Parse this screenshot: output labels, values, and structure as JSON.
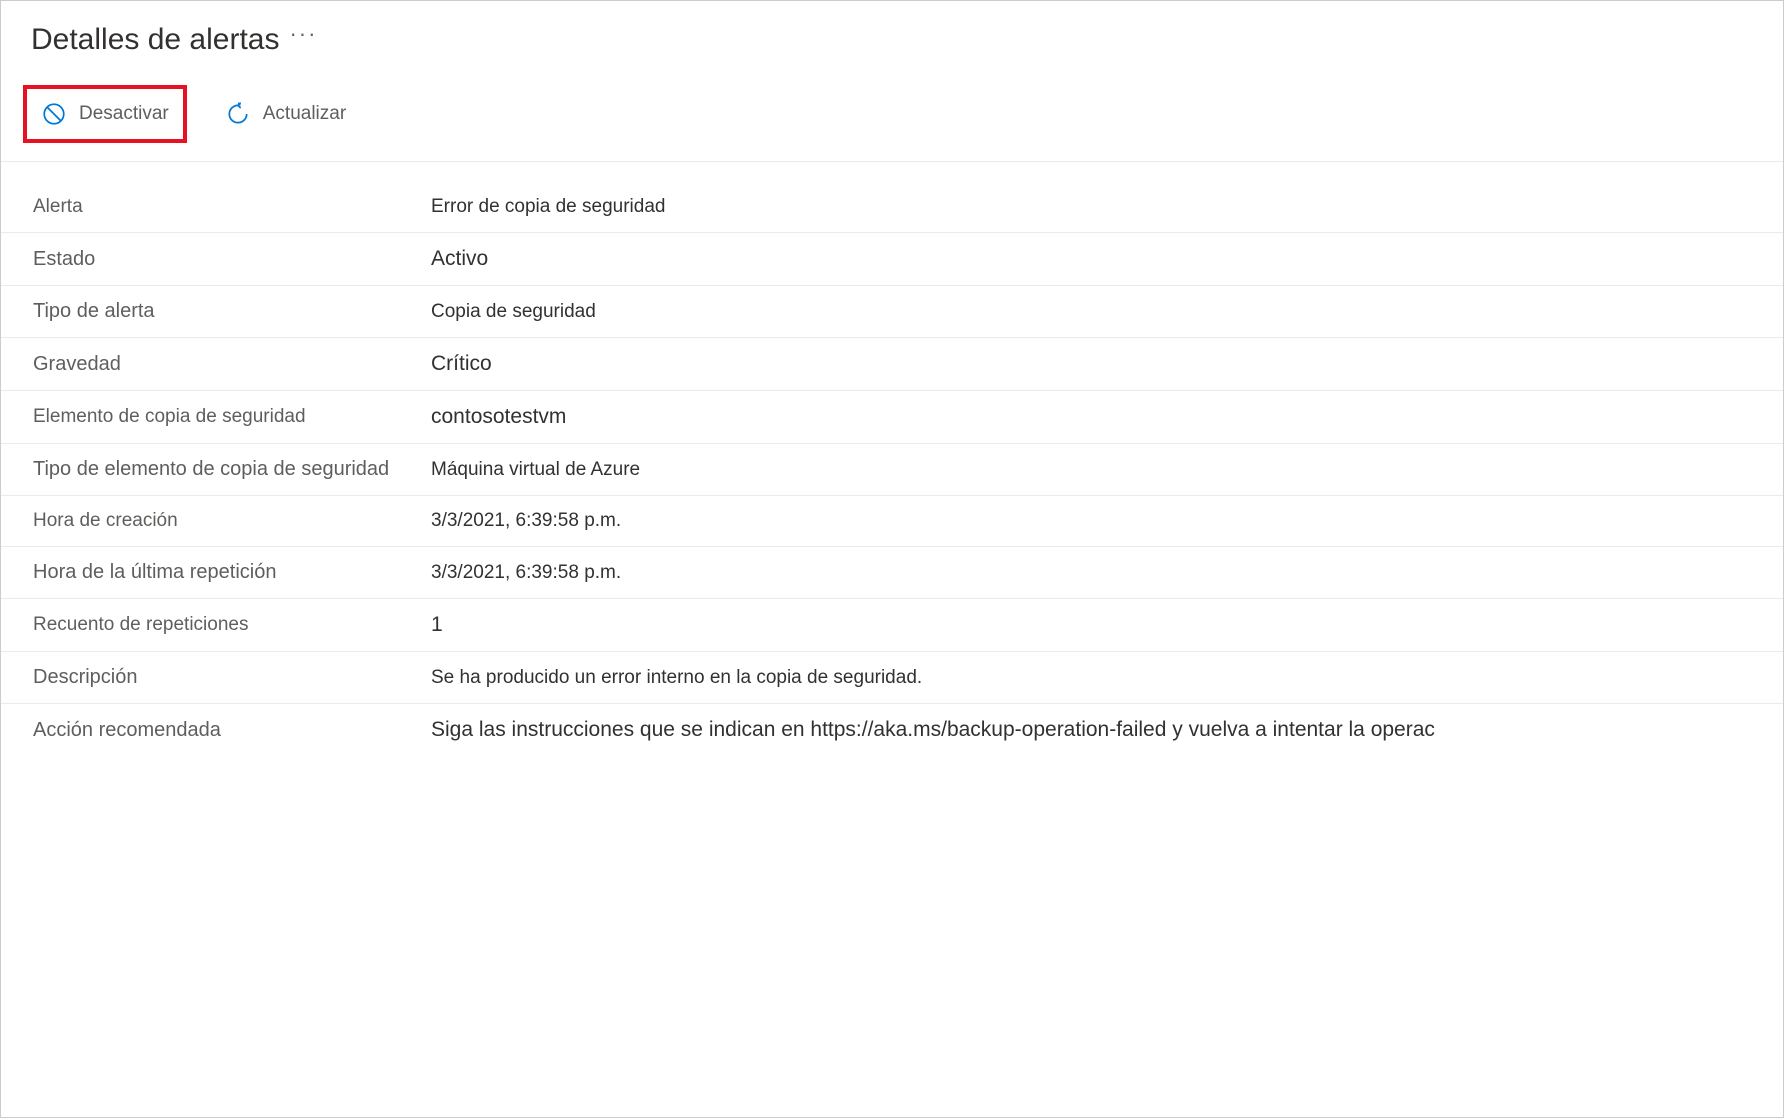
{
  "header": {
    "title": "Detalles de alertas"
  },
  "toolbar": {
    "deactivate_label": "Desactivar",
    "refresh_label": "Actualizar"
  },
  "details": {
    "alert_label": "Alerta",
    "alert_value": "Error de copia de seguridad",
    "state_label": "Estado",
    "state_value": "Activo",
    "alert_type_label": "Tipo de alerta",
    "alert_type_value": "Copia de seguridad",
    "severity_label": "Gravedad",
    "severity_value": "Crítico",
    "backup_item_label": "Elemento de copia de seguridad",
    "backup_item_value": "contosotestvm",
    "backup_item_type_label": "Tipo de elemento de copia de seguridad",
    "backup_item_type_value": "Máquina virtual de Azure",
    "creation_time_label": "Hora de creación",
    "creation_time_value": "3/3/2021, 6:39:58 p.m.",
    "last_repeat_time_label": "Hora de la última repetición",
    "last_repeat_time_value": "3/3/2021, 6:39:58 p.m.",
    "repeat_count_label": "Recuento de repeticiones",
    "repeat_count_value": "1",
    "description_label": "Descripción",
    "description_value": "Se ha producido un error interno en la copia de seguridad.",
    "recommended_action_label": "Acción recomendada",
    "recommended_action_value": "Siga las instrucciones que se indican en https://aka.ms/backup-operation-failed y vuelva a intentar la operac"
  }
}
